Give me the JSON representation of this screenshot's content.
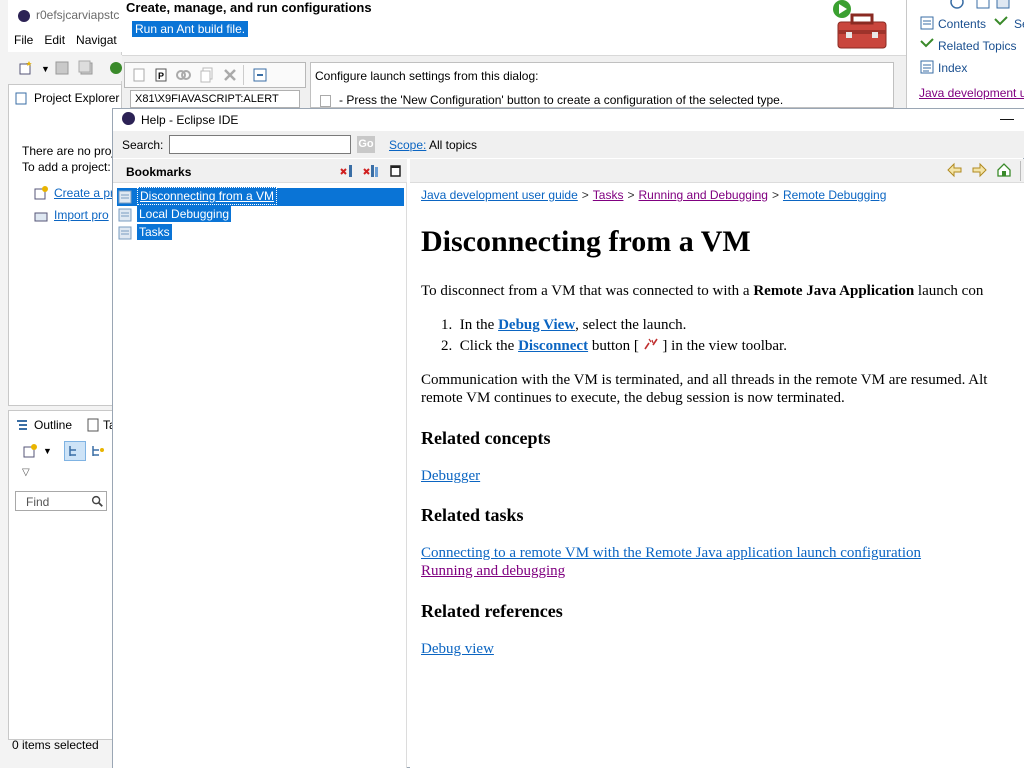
{
  "workbench": {
    "window_title": "r0efsjcarviapstc",
    "menu": [
      "File",
      "Edit",
      "Navigat"
    ],
    "project_explorer_tab": "Project Explorer",
    "pe_text_1": "There are no proj",
    "pe_text_2": "To add a project:",
    "pe_link_1": "Create a pr",
    "pe_link_2": "Import pro",
    "outline_tab": "Outline",
    "task_tab": "Ta",
    "find_placeholder": "Find",
    "status": "0 items selected"
  },
  "launch_dialog": {
    "title": "Create, manage, and run configurations",
    "subtitle": "Run an Ant build file.",
    "filter_text": "X81\\X9FIAVASCRIPT:ALERT",
    "description": "Configure launch settings from this dialog:",
    "bullet": "- Press the 'New Configuration' button to create a configuration of the selected type."
  },
  "help_view": {
    "items": [
      "Contents",
      "Se",
      "Related Topics",
      "Index"
    ],
    "link": "Java development u"
  },
  "help_window": {
    "title": "Help - Eclipse IDE",
    "search_label": "Search:",
    "search_value": "",
    "go_label": "Go",
    "scope_label": "Scope:",
    "scope_value": "All topics",
    "bookmarks_title": "Bookmarks",
    "bookmarks": [
      "Disconnecting from a VM",
      "Local Debugging",
      "Tasks"
    ],
    "breadcrumb": [
      "Java development user guide",
      "Tasks",
      "Running and Debugging",
      "Remote Debugging"
    ],
    "heading": "Disconnecting from a VM",
    "intro_pre": "To disconnect from a VM that was connected to with a ",
    "intro_bold": "Remote Java Application",
    "intro_post": " launch con",
    "steps": {
      "s1_num": "1.",
      "s1_pre": "In the ",
      "s1_link": "Debug View",
      "s1_post": ", select the launch.",
      "s2_num": "2.",
      "s2_pre": "Click the ",
      "s2_link": "Disconnect",
      "s2_mid": " button [ ",
      "s2_post": " ] in the view toolbar."
    },
    "para_1": "Communication with the VM is terminated, and all threads in the remote VM are resumed. Alt",
    "para_2": "remote VM continues to execute, the debug session is now terminated.",
    "related_concepts": "Related concepts",
    "concept_link": "Debugger",
    "related_tasks": "Related tasks",
    "task_link_1": "Connecting to a remote VM with the Remote Java application launch configuration",
    "task_link_2": "Running and debugging",
    "related_references": "Related references",
    "reference_link": "Debug view"
  },
  "colors": {
    "selection": "#0a74d6",
    "link": "#0b65c2",
    "visited": "#800080"
  }
}
